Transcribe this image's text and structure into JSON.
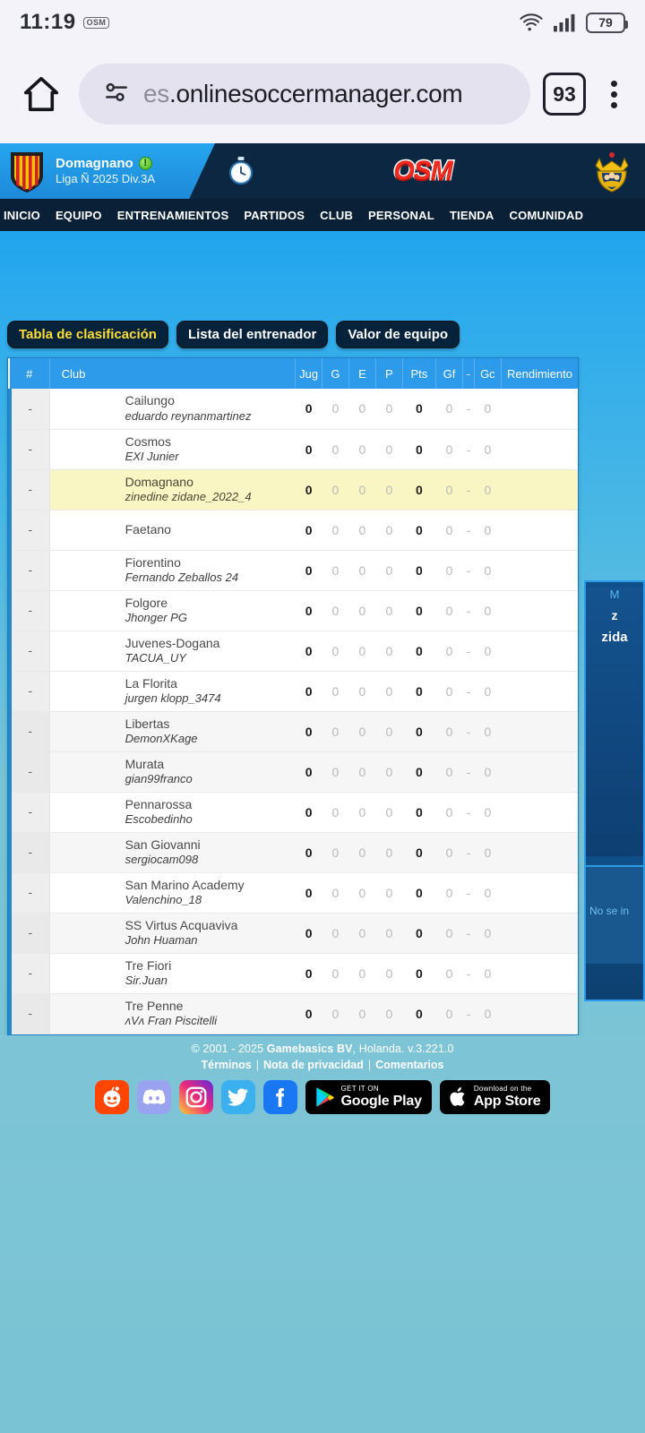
{
  "status_bar": {
    "time": "11:19",
    "app_badge": "OSM",
    "wifi_icon": "wifi-icon",
    "signal_icon": "cellular-signal-icon",
    "battery_level": "79"
  },
  "browser": {
    "home_icon": "home-icon",
    "site_info_icon": "site-settings-icon",
    "url_faded": "es",
    "url": ".onlinesoccermanager.com",
    "tab_count": "93",
    "menu_icon": "overflow-menu-icon"
  },
  "game_header": {
    "crest_icon": "club-crest-icon",
    "club_name": "Domagnano",
    "status_badge": "!",
    "league": "Liga Ñ 2025 Div.3A",
    "clock_icon": "match-clock-icon",
    "logo": "OSM",
    "trophy_icon": "trophy-icon"
  },
  "nav": {
    "items": [
      {
        "label": "INICIO"
      },
      {
        "label": "EQUIPO"
      },
      {
        "label": "ENTRENAMIENTOS"
      },
      {
        "label": "PARTIDOS"
      },
      {
        "label": "CLUB"
      },
      {
        "label": "PERSONAL"
      },
      {
        "label": "TIENDA"
      },
      {
        "label": "COMUNIDAD"
      }
    ]
  },
  "tabs": [
    {
      "label": "Tabla de clasificación",
      "active": true
    },
    {
      "label": "Lista del entrenador",
      "active": false
    },
    {
      "label": "Valor de equipo",
      "active": false
    }
  ],
  "table": {
    "headers": {
      "rank": "#",
      "club": "Club",
      "played": "Jug",
      "won": "G",
      "drawn": "E",
      "lost": "P",
      "points": "Pts",
      "goals_for": "Gf",
      "dash": "-",
      "goals_against": "Gc",
      "performance": "Rendimiento"
    },
    "rows": [
      {
        "rank": "-",
        "club": "Cailungo",
        "manager": "eduardo reynanmartinez",
        "jug": "0",
        "g": "0",
        "e": "0",
        "p": "0",
        "pts": "0",
        "gf": "0",
        "dash": "-",
        "gc": "0",
        "rend": ""
      },
      {
        "rank": "-",
        "club": "Cosmos",
        "manager": "EXI Junier",
        "jug": "0",
        "g": "0",
        "e": "0",
        "p": "0",
        "pts": "0",
        "gf": "0",
        "dash": "-",
        "gc": "0",
        "rend": ""
      },
      {
        "rank": "-",
        "club": "Domagnano",
        "manager": "zinedine zidane_2022_4",
        "jug": "0",
        "g": "0",
        "e": "0",
        "p": "0",
        "pts": "0",
        "gf": "0",
        "dash": "-",
        "gc": "0",
        "rend": ""
      },
      {
        "rank": "-",
        "club": "Faetano",
        "manager": "",
        "jug": "0",
        "g": "0",
        "e": "0",
        "p": "0",
        "pts": "0",
        "gf": "0",
        "dash": "-",
        "gc": "0",
        "rend": ""
      },
      {
        "rank": "-",
        "club": "Fiorentino",
        "manager": "Fernando Zeballos 24",
        "jug": "0",
        "g": "0",
        "e": "0",
        "p": "0",
        "pts": "0",
        "gf": "0",
        "dash": "-",
        "gc": "0",
        "rend": ""
      },
      {
        "rank": "-",
        "club": "Folgore",
        "manager": "Jhonger PG",
        "jug": "0",
        "g": "0",
        "e": "0",
        "p": "0",
        "pts": "0",
        "gf": "0",
        "dash": "-",
        "gc": "0",
        "rend": ""
      },
      {
        "rank": "-",
        "club": "Juvenes-Dogana",
        "manager": "TACUA_UY",
        "jug": "0",
        "g": "0",
        "e": "0",
        "p": "0",
        "pts": "0",
        "gf": "0",
        "dash": "-",
        "gc": "0",
        "rend": ""
      },
      {
        "rank": "-",
        "club": "La Florita",
        "manager": "jurgen klopp_3474",
        "jug": "0",
        "g": "0",
        "e": "0",
        "p": "0",
        "pts": "0",
        "gf": "0",
        "dash": "-",
        "gc": "0",
        "rend": ""
      },
      {
        "rank": "-",
        "club": "Libertas",
        "manager": "DemonXKage",
        "jug": "0",
        "g": "0",
        "e": "0",
        "p": "0",
        "pts": "0",
        "gf": "0",
        "dash": "-",
        "gc": "0",
        "rend": ""
      },
      {
        "rank": "-",
        "club": "Murata",
        "manager": "gian99franco",
        "jug": "0",
        "g": "0",
        "e": "0",
        "p": "0",
        "pts": "0",
        "gf": "0",
        "dash": "-",
        "gc": "0",
        "rend": ""
      },
      {
        "rank": "-",
        "club": "Pennarossa",
        "manager": "Escobedinho",
        "jug": "0",
        "g": "0",
        "e": "0",
        "p": "0",
        "pts": "0",
        "gf": "0",
        "dash": "-",
        "gc": "0",
        "rend": ""
      },
      {
        "rank": "-",
        "club": "San Giovanni",
        "manager": "sergiocam098",
        "jug": "0",
        "g": "0",
        "e": "0",
        "p": "0",
        "pts": "0",
        "gf": "0",
        "dash": "-",
        "gc": "0",
        "rend": ""
      },
      {
        "rank": "-",
        "club": "San Marino Academy",
        "manager": "Valenchino_18",
        "jug": "0",
        "g": "0",
        "e": "0",
        "p": "0",
        "pts": "0",
        "gf": "0",
        "dash": "-",
        "gc": "0",
        "rend": ""
      },
      {
        "rank": "-",
        "club": "SS Virtus Acquaviva",
        "manager": "John Huaman",
        "jug": "0",
        "g": "0",
        "e": "0",
        "p": "0",
        "pts": "0",
        "gf": "0",
        "dash": "-",
        "gc": "0",
        "rend": ""
      },
      {
        "rank": "-",
        "club": "Tre Fiori",
        "manager": "Sir.Juan",
        "jug": "0",
        "g": "0",
        "e": "0",
        "p": "0",
        "pts": "0",
        "gf": "0",
        "dash": "-",
        "gc": "0",
        "rend": ""
      },
      {
        "rank": "-",
        "club": "Tre Penne",
        "manager": "ʌVʌ Fran Piscitelli",
        "jug": "0",
        "g": "0",
        "e": "0",
        "p": "0",
        "pts": "0",
        "gf": "0",
        "dash": "-",
        "gc": "0",
        "rend": ""
      }
    ]
  },
  "side_panel": {
    "line1": "M",
    "line2": "z",
    "line3": "zida",
    "note": "No se in"
  },
  "footer": {
    "copyright_pre": "© 2001 - 2025 ",
    "company": "Gamebasics BV",
    "copyright_post": ", Holanda. v.3.221.0",
    "link_terms": "Términos",
    "link_privacy": "Nota de privacidad",
    "link_feedback": "Comentarios",
    "separator": "|",
    "social": [
      {
        "name": "reddit-icon",
        "label": "Reddit"
      },
      {
        "name": "discord-icon",
        "label": "Discord"
      },
      {
        "name": "instagram-icon",
        "label": "Instagram"
      },
      {
        "name": "twitter-icon",
        "label": "Twitter"
      },
      {
        "name": "facebook-icon",
        "label": "Facebook"
      }
    ],
    "google_play_small": "GET IT ON",
    "google_play_big": "Google Play",
    "app_store_small": "Download on the",
    "app_store_big": "App Store"
  },
  "colors": {
    "accent_blue": "#2d9bea",
    "header_dark": "#0c2741",
    "page_teal": "#7dc5d6",
    "highlight_row": "#faf6c4",
    "tab_active_text": "#ffdd33"
  }
}
